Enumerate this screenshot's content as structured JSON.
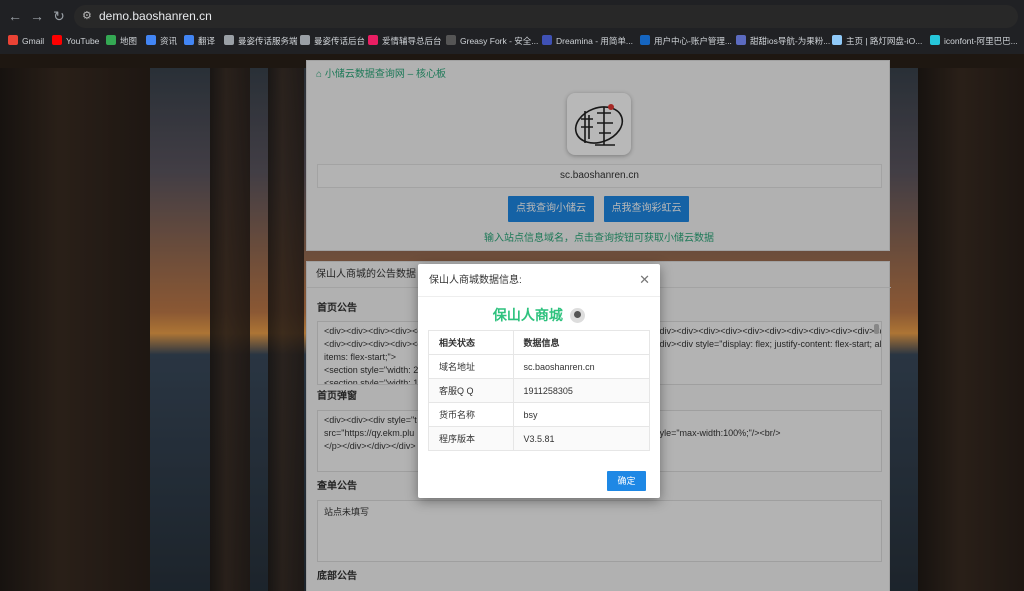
{
  "browser": {
    "url": "demo.baoshanren.cn",
    "bookmarks": [
      {
        "label": "Gmail",
        "color": "#ea4335"
      },
      {
        "label": "YouTube",
        "color": "#ff0000"
      },
      {
        "label": "地图",
        "color": "#34a853"
      },
      {
        "label": "资讯",
        "color": "#4285f4"
      },
      {
        "label": "翻译",
        "color": "#4285f4"
      },
      {
        "label": "曼姿传话服务端",
        "color": "#9aa0a6"
      },
      {
        "label": "曼姿传话后台",
        "color": "#9aa0a6"
      },
      {
        "label": "爱情辅导总后台",
        "color": "#e91e63"
      },
      {
        "label": "Greasy Fork - 安全...",
        "color": "#555555"
      },
      {
        "label": "Dreamina - 用简单...",
        "color": "#3f51b5"
      },
      {
        "label": "用户中心-账户管理...",
        "color": "#1565c0"
      },
      {
        "label": "甜甜ios导航-为果粉...",
        "color": "#5c6bc0"
      },
      {
        "label": "主页 | 路灯网盘-iO...",
        "color": "#90caf9"
      },
      {
        "label": "iconfont-阿里巴巴...",
        "color": "#26c6da"
      }
    ]
  },
  "header": {
    "title": "小储云数据查询网 – 核心板",
    "domain_value": "sc.baoshanren.cn",
    "query_xcy_label": "点我查询小储云",
    "query_rainbow_label": "点我查询彩虹云",
    "hint": "输入站点信息域名，点击查询按钮可获取小储云数据"
  },
  "notices": {
    "heading": "保山人商城的公告数据",
    "home": {
      "title": "首页公告",
      "lines": [
        "<div><div><div><div><div><div><div><div><div><div><div><div><div><div><div><div><div><div><div><div><div><div><div><div><div><div><div>",
        "<div><div><div><div><div><div><div><div><div><div><div><div><div><div><div><div><div style=\"display: flex; justify-content: flex-start; align-",
        "items: flex-start;\">",
        "<section style=\"width: 2",
        "<section style=\"width: 1"
      ]
    },
    "popup": {
      "title": "首页弹窗",
      "lines": [
        "<div><div><div style=\"t",
        "src=\"https://qy.ekm.plu                                                                   d129a0f721.png\" style=\"max-width:100%;\"/><br/>",
        "</p></div></div></div>"
      ]
    },
    "order": {
      "title": "查单公告",
      "text": "站点未填写"
    },
    "bottom": {
      "title": "底部公告"
    }
  },
  "modal": {
    "title": "保山人商城数据信息:",
    "store_name": "保山人商城",
    "table_headers": [
      "相关状态",
      "数据信息"
    ],
    "rows": [
      {
        "label": "域名地址",
        "value": "sc.baoshanren.cn"
      },
      {
        "label": "客服Q Q",
        "value": "1911258305"
      },
      {
        "label": "货币名称",
        "value": "bsy"
      },
      {
        "label": "程序版本",
        "value": "V3.5.81"
      }
    ],
    "ok_label": "确定"
  },
  "colors": {
    "accent_green": "#2aa87a",
    "button_blue": "#1e88e5"
  }
}
